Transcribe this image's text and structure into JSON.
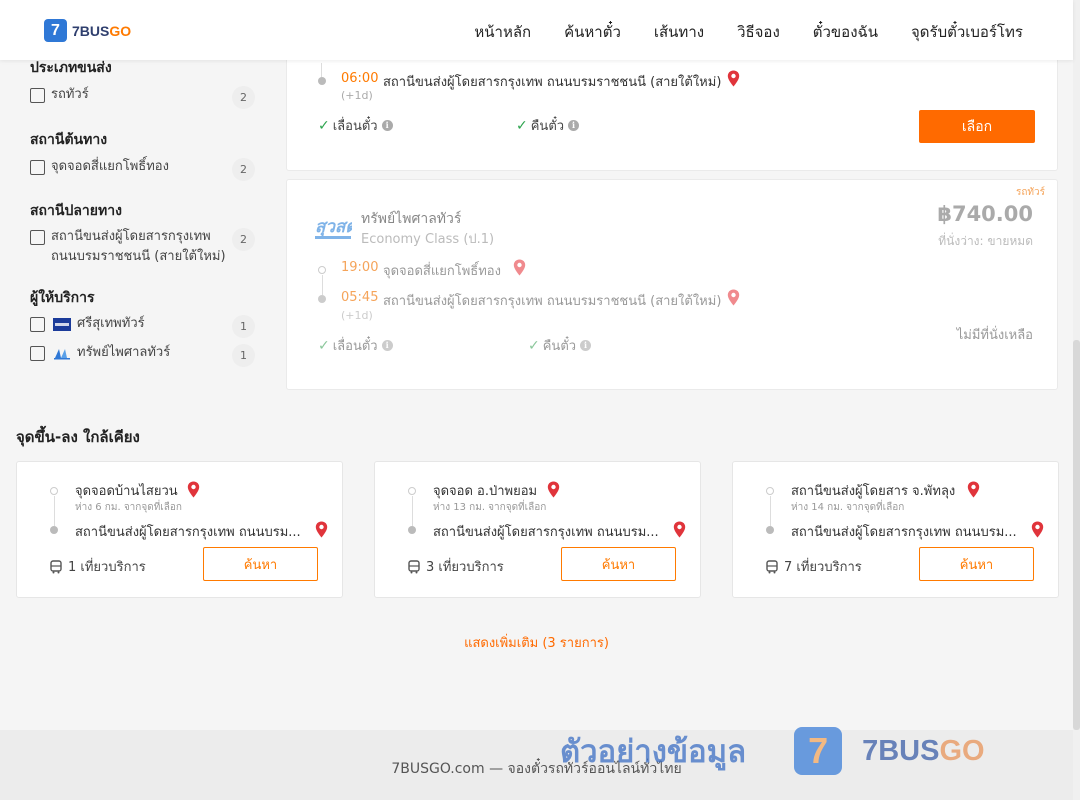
{
  "header": {
    "logo_mark": "7",
    "logo_brand_a": "7BUS",
    "logo_brand_b": "GO",
    "nav": [
      "หน้าหลัก",
      "ค้นหาตั๋ว",
      "เส้นทาง",
      "วิธีจอง",
      "ตั๋วของฉัน",
      "จุดรับตั๋วเบอร์โทร"
    ]
  },
  "sidebar": {
    "groups": [
      {
        "title": "ประเภทขนส่ง",
        "items": [
          {
            "label": "รถทัวร์",
            "count": "2"
          }
        ]
      },
      {
        "title": "สถานีต้นทาง",
        "items": [
          {
            "label": "จุดจอดสี่แยกโพธิ์ทอง",
            "count": "2"
          }
        ]
      },
      {
        "title": "สถานีปลายทาง",
        "items": [
          {
            "label_line1": "สถานีขนส่งผู้โดยสารกรุงเทพ",
            "label_line2": "ถนนบรมราชชนนี (สายใต้ใหม่)",
            "count": "2"
          }
        ]
      },
      {
        "title": "ผู้ให้บริการ",
        "items": [
          {
            "label": "ศรีสุเทพทัวร์",
            "count": "1"
          },
          {
            "label": "ทรัพย์ไพศาลทัวร์",
            "count": "1"
          }
        ]
      }
    ]
  },
  "card1": {
    "arrive_time": "06:00",
    "arrive_stop": "สถานีขนส่งผู้โดยสารกรุงเทพ ถนนบรมราชชนนี (สายใต้ใหม่)",
    "day_offset": "(+1d)",
    "feature_1": "เลื่อนตั๋ว",
    "feature_2": "คืนตั๋ว",
    "select_label": "เลือก"
  },
  "card2": {
    "tag": "รถทัวร์",
    "operator_logo_text": "สุวสต",
    "operator": "ทรัพย์ไพศาลทัวร์",
    "class": "Economy Class (ป.1)",
    "price": "฿740.00",
    "seats": "ที่นั่งว่าง: ขายหมด",
    "depart_time": "19:00",
    "depart_stop": "จุดจอดสี่แยกโพธิ์ทอง",
    "arrive_time": "05:45",
    "arrive_stop": "สถานีขนส่งผู้โดยสารกรุงเทพ ถนนบรมราชชนนี (สายใต้ใหม่)",
    "day_offset": "(+1d)",
    "no_seats": "ไม่มีที่นั่งเหลือ",
    "feature_1": "เลื่อนตั๋ว",
    "feature_2": "คืนตั๋ว"
  },
  "nearby": {
    "title": "จุดขึ้น-ลง ใกล้เคียง",
    "cards": [
      {
        "from": "จุดจอดบ้านไสยวน",
        "dist": "ห่าง 6 กม. จากจุดที่เลือก",
        "to": "สถานีขนส่งผู้โดยสารกรุงเทพ ถนนบรม...",
        "trips": "1 เที่ยวบริการ",
        "btn": "ค้นหา"
      },
      {
        "from": "จุดจอด อ.ป่าพยอม",
        "dist": "ห่าง 13 กม. จากจุดที่เลือก",
        "to": "สถานีขนส่งผู้โดยสารกรุงเทพ ถนนบรม...",
        "trips": "3 เที่ยวบริการ",
        "btn": "ค้นหา"
      },
      {
        "from": "สถานีขนส่งผู้โดยสาร จ.พัทลุง",
        "dist": "ห่าง 14 กม. จากจุดที่เลือก",
        "to": "สถานีขนส่งผู้โดยสารกรุงเทพ ถนนบรม...",
        "trips": "7 เที่ยวบริการ",
        "btn": "ค้นหา"
      }
    ],
    "more": "แสดงเพิ่มเติม (3 รายการ)"
  },
  "footer": {
    "text": "7BUSGO.com — จองตั๋วรถทัวร์ออนไลน์ทั่วไทย"
  },
  "watermark": {
    "text": "ตัวอย่างข้อมูล",
    "mark": "7",
    "brand_a": "7BUS",
    "brand_b": "GO"
  },
  "colors": {
    "accent": "#ff6a00",
    "brand_blue": "#2f78d6",
    "check_green": "#2da44e",
    "pin_red": "#e0343b"
  }
}
